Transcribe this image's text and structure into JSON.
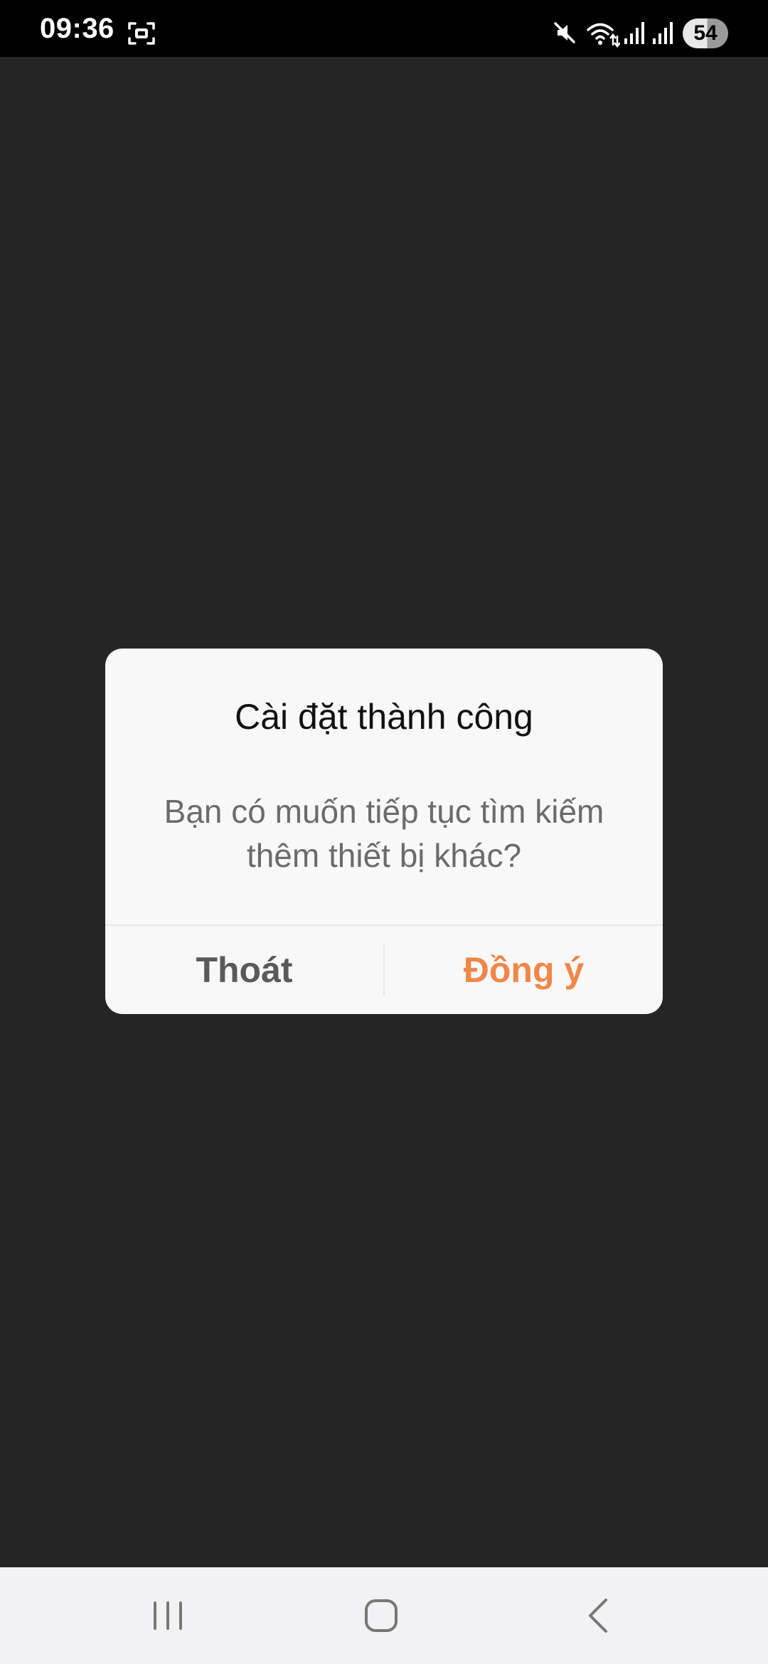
{
  "status_bar": {
    "time": "09:36",
    "battery_level": "54",
    "icons": [
      "screenshot-icon",
      "mute-icon",
      "wifi-icon",
      "signal-icon",
      "signal-icon",
      "battery-icon"
    ]
  },
  "dialog": {
    "title": "Cài đặt thành công",
    "message_line1": "Bạn có muốn tiếp tục tìm kiếm",
    "message_line2": "thêm thiết bị khác?",
    "exit_label": "Thoát",
    "agree_label": "Đồng ý"
  },
  "nav_bar": {
    "icons": [
      "recent-apps-icon",
      "home-icon",
      "back-icon"
    ]
  },
  "colors": {
    "background": "#252525",
    "dialog_bg": "#f8f8f8",
    "accent": "#ef8748",
    "nav_bar": "#f2f2f4"
  }
}
